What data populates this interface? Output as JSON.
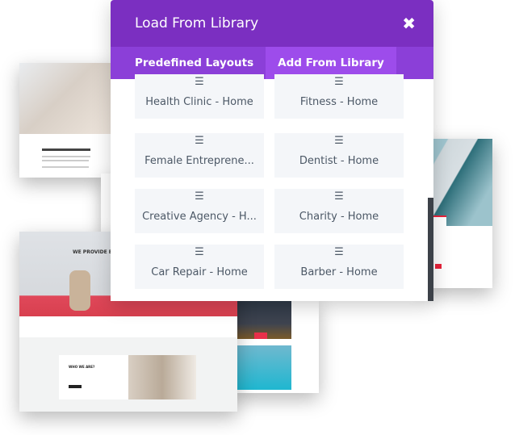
{
  "modal": {
    "title": "Load From Library",
    "close_icon": "close-x-icon",
    "tabs": [
      {
        "label": "Predefined Layouts",
        "active": false
      },
      {
        "label": "Add From Library",
        "active": true
      }
    ],
    "layouts": [
      {
        "label": "Health Clinic - Home"
      },
      {
        "label": "Fitness - Home"
      },
      {
        "label": "Female Entreprene..."
      },
      {
        "label": "Dentist - Home"
      },
      {
        "label": "Creative Agency - H..."
      },
      {
        "label": "Charity - Home"
      },
      {
        "label": "Car Repair - Home"
      },
      {
        "label": "Barber - Home"
      }
    ],
    "item_icon": "hamburger-icon",
    "colors": {
      "header": "#7b2fc1",
      "tabs": "#8b3fd8",
      "active_tab": "#9d4ceb"
    }
  },
  "previews": {
    "car_heading": "WE PROVIDE B",
    "who_heading": "WHO WE ARE?"
  }
}
